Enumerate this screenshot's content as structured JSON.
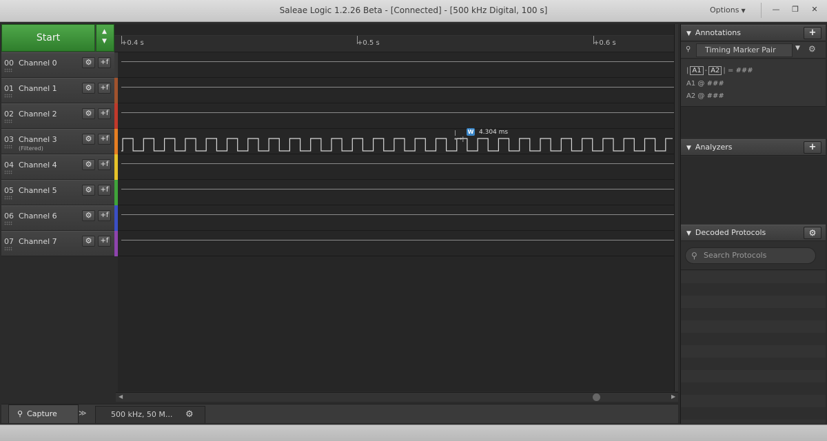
{
  "window": {
    "title": "Saleae Logic 1.2.26 Beta - [Connected] - [500 kHz Digital, 100 s]",
    "options_label": "Options",
    "minimize_glyph": "—",
    "maximize_glyph": "❐",
    "close_glyph": "✕"
  },
  "start": {
    "label": "Start"
  },
  "channels": [
    {
      "num": "00",
      "name": "Channel 0",
      "sub": "",
      "color": "#3a3a3a"
    },
    {
      "num": "01",
      "name": "Channel 1",
      "sub": "",
      "color": "#a0522d"
    },
    {
      "num": "02",
      "name": "Channel 2",
      "sub": "",
      "color": "#c0392b"
    },
    {
      "num": "03",
      "name": "Channel 3",
      "sub": "(Filtered)",
      "color": "#e67e22"
    },
    {
      "num": "04",
      "name": "Channel 4",
      "sub": "",
      "color": "#e6c229"
    },
    {
      "num": "05",
      "name": "Channel 5",
      "sub": "",
      "color": "#3fa33a"
    },
    {
      "num": "06",
      "name": "Channel 6",
      "sub": "",
      "color": "#3b4fc4"
    },
    {
      "num": "07",
      "name": "Channel 7",
      "sub": "",
      "color": "#8e44ad"
    }
  ],
  "ruler": {
    "ticks": [
      "+0.4 s",
      "+0.5 s",
      "+0.6 s"
    ]
  },
  "measurement": {
    "badge": "W",
    "value": "4.304 ms"
  },
  "bottom": {
    "capture_tab": "Capture",
    "more_glyph": "≫",
    "settings_tab": "500 kHz, 50 M..."
  },
  "annotations": {
    "title": "Annotations",
    "add_glyph": "+",
    "timing_marker": "Timing Marker Pair",
    "a1": "A1",
    "a2": "A2",
    "diff_value": "###",
    "a1_label": "A1",
    "a1_value": "###",
    "a2_label": "A2",
    "a2_value": "###",
    "at_symbol": "@"
  },
  "analyzers": {
    "title": "Analyzers",
    "add_glyph": "+"
  },
  "decoded": {
    "title": "Decoded Protocols",
    "search_placeholder": "Search Protocols"
  },
  "colors": {
    "accent_green": "#3f9a3a",
    "marker_blue": "#3a86c8"
  }
}
